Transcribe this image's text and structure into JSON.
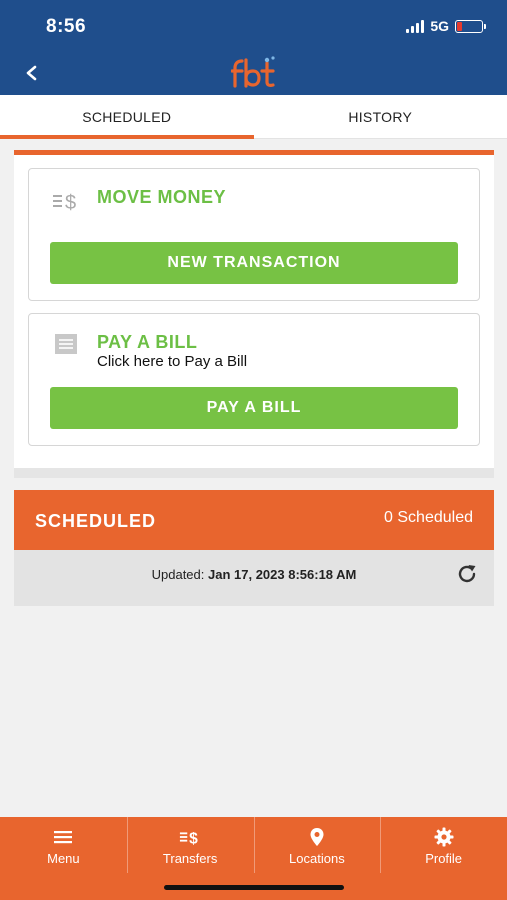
{
  "status_bar": {
    "time": "8:56",
    "network": "5G"
  },
  "colors": {
    "brand_blue": "#1f4e8c",
    "accent_orange": "#e8652e",
    "action_green": "#77c244"
  },
  "icons": [
    "chevron-left-icon",
    "fbt-logo",
    "transfer-dollar-icon",
    "bill-icon",
    "refresh-icon",
    "menu-icon",
    "pin-icon",
    "gear-icon"
  ],
  "tabs": [
    {
      "label": "SCHEDULED",
      "active": true
    },
    {
      "label": "HISTORY",
      "active": false
    }
  ],
  "move_money": {
    "title": "MOVE MONEY",
    "button": "NEW TRANSACTION"
  },
  "pay_bill": {
    "title": "PAY A BILL",
    "subtitle": "Click here to Pay a Bill",
    "button": "PAY A BILL"
  },
  "scheduled": {
    "title": "SCHEDULED",
    "count": "0 Scheduled",
    "updated_label": "Updated:",
    "updated_value": "Jan 17, 2023 8:56:18 AM"
  },
  "bottom_nav": [
    {
      "label": "Menu"
    },
    {
      "label": "Transfers"
    },
    {
      "label": "Locations"
    },
    {
      "label": "Profile"
    }
  ]
}
